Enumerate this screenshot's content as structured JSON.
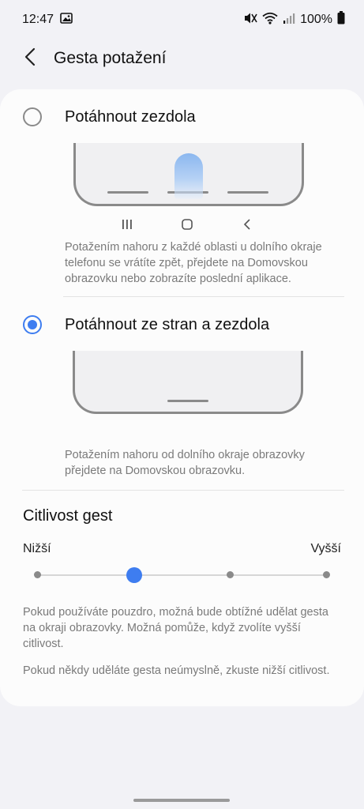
{
  "status_bar": {
    "time": "12:47",
    "battery_text": "100%",
    "icons": [
      "gallery-icon",
      "mute-icon",
      "wifi-icon",
      "signal-icon",
      "battery-icon"
    ]
  },
  "header": {
    "title": "Gesta potažení",
    "back_icon": "back-arrow-icon"
  },
  "options": [
    {
      "label": "Potáhnout zezdola",
      "selected": false,
      "description": "Potažením nahoru z každé oblasti u dolního okraje telefonu se vrátíte zpět, přejdete na Domovskou obrazovku nebo zobrazíte poslední aplikace."
    },
    {
      "label": "Potáhnout ze stran a zezdola",
      "selected": true,
      "description": "Potažením nahoru od dolního okraje obrazovky přejdete na Domovskou obrazovku."
    }
  ],
  "nav_icons": [
    "recents-icon",
    "home-icon",
    "back-icon"
  ],
  "sensitivity": {
    "title": "Citlivost gest",
    "min_label": "Nižší",
    "max_label": "Vyšší",
    "steps": 4,
    "selected_step": 1,
    "help_text_1": "Pokud používáte pouzdro, možná bude obtížné udělat gesta na okraji obrazovky. Možná pomůže, když zvolíte vyšší citlivost.",
    "help_text_2": "Pokud někdy uděláte gesta neúmyslně, zkuste nižší citlivost."
  },
  "colors": {
    "accent": "#3e7df0",
    "background": "#f2f2f6",
    "card": "#fcfcfc",
    "secondary_text": "#7a7a7a"
  }
}
